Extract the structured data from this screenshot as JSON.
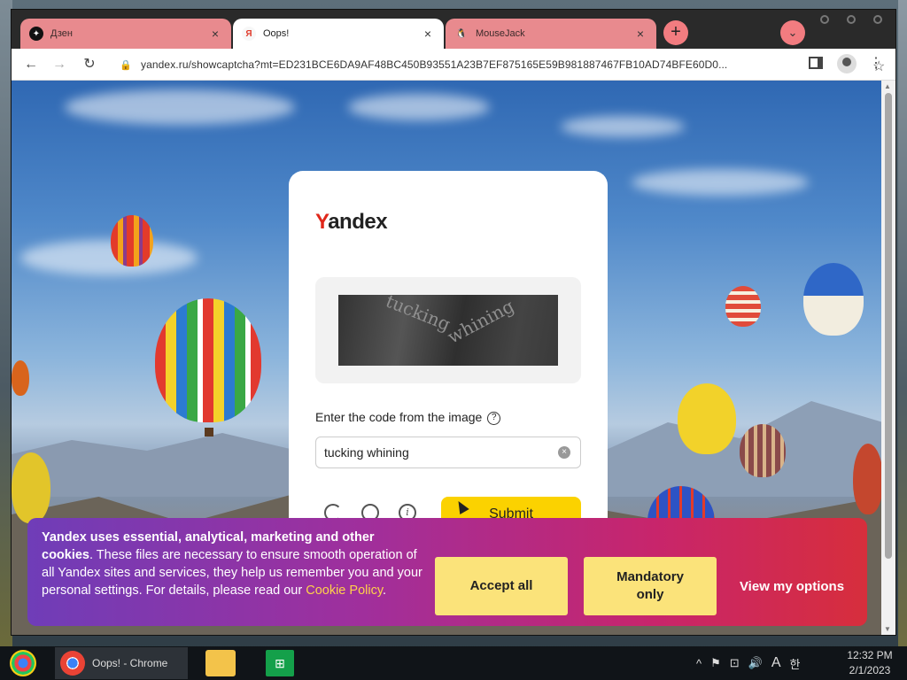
{
  "browser": {
    "tabs": [
      {
        "label": "Дзен",
        "icon": "zen-icon"
      },
      {
        "label": "Oops!",
        "icon": "yandex-favicon"
      },
      {
        "label": "MouseJack",
        "icon": "penguin-icon"
      }
    ],
    "url": "yandex.ru/showcaptcha?mt=ED231BCE6DA9AF48BC450B93551A23B7EF875165E59B981887467FB10AD74BFE60D0..."
  },
  "captcha": {
    "logo_y": "Y",
    "logo_rest": "andex",
    "image_word_1": "tucking",
    "image_word_2": "whining",
    "prompt": "Enter the code from the image",
    "input_value": "tucking whining",
    "submit_label": "Submit"
  },
  "cookies": {
    "text_bold": "Yandex uses essential, analytical, marketing and other cookies",
    "text_body": ". These files are necessary to ensure smooth operation of all Yandex sites and services, they help us remember you and your personal settings. For details, please read our ",
    "link_text": "Cookie Policy",
    "text_end": ".",
    "accept_all": "Accept all",
    "mandatory_only": "Mandatory only",
    "view_options": "View my options"
  },
  "taskbar": {
    "chrome_label": "Oops! - Chrome",
    "time": "12:32 PM",
    "date": "2/1/2023",
    "language": "A"
  },
  "colors": {
    "tab_inactive": "#e88a8e",
    "submit": "#fbd200",
    "cookie_button": "#fbe37a",
    "yandex_red": "#e0271a"
  }
}
